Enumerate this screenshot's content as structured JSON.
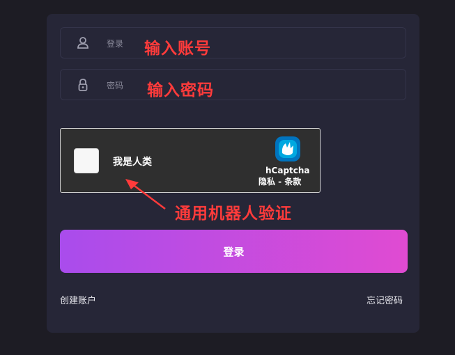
{
  "login_form": {
    "username": {
      "placeholder": "登录",
      "annotation": "输入账号",
      "icon": "user-icon"
    },
    "password": {
      "placeholder": "密码",
      "annotation": "输入密码",
      "icon": "lock-icon"
    },
    "captcha": {
      "checkbox_label": "我是人类",
      "brand": "hCaptcha",
      "links": "隐私 - 条款",
      "annotation": "通用机器人验证",
      "icon": "hcaptcha-logo-icon"
    },
    "submit_label": "登录",
    "create_account": "创建账户",
    "forgot_password": "忘记密码"
  },
  "colors": {
    "background": "#1d1c24",
    "card": "#262637",
    "annotation": "#ff3b3b",
    "button_gradient_start": "#a94cec",
    "button_gradient_end": "#e04bd2"
  }
}
